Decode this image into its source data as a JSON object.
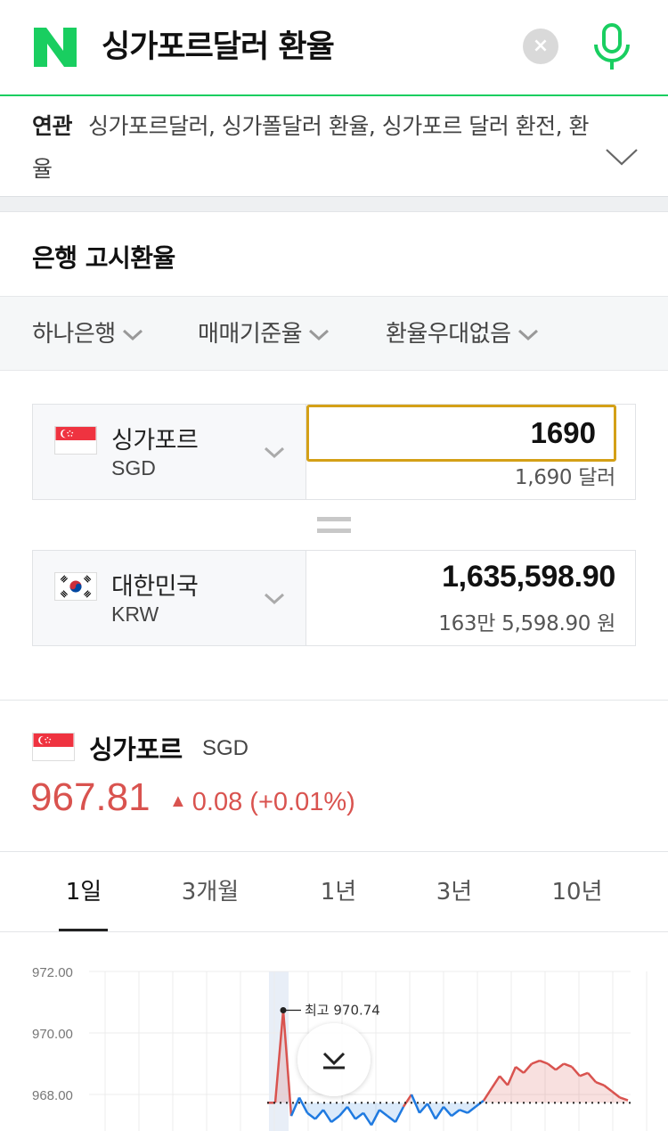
{
  "search": {
    "query": "싱가포르달러 환율",
    "clear_label": "×",
    "brand_color": "#19ce60"
  },
  "related": {
    "label": "연관",
    "terms": "싱가포르달러, 싱가폴달러 환율, 싱가포르 달러 환전, 환율"
  },
  "bank_rates": {
    "title": "은행 고시환율",
    "filters": {
      "bank": "하나은행",
      "rate_type": "매매기준율",
      "discount": "환율우대없음"
    }
  },
  "converter": {
    "from": {
      "name": "싱가포르",
      "code": "SGD",
      "input_value": "1690",
      "sub_text": "1,690 달러"
    },
    "to": {
      "name": "대한민국",
      "code": "KRW",
      "value": "1,635,598.90",
      "sub_text": "163만 5,598.90 원"
    }
  },
  "rate_summary": {
    "name": "싱가포르",
    "code": "SGD",
    "value": "967.81",
    "change": "0.08 (+0.01%)",
    "up_color": "#d9534f",
    "down_color": "#1f7ae0"
  },
  "tabs": [
    {
      "label": "1일",
      "active": true
    },
    {
      "label": "3개월",
      "active": false
    },
    {
      "label": "1년",
      "active": false
    },
    {
      "label": "3년",
      "active": false
    },
    {
      "label": "10년",
      "active": false
    }
  ],
  "chart_data": {
    "type": "line",
    "yticks": [
      "972.00",
      "970.00",
      "968.00"
    ],
    "ylim": [
      966.2,
      972.5
    ],
    "baseline": 967.73,
    "high_label": "최고 970.74",
    "high_value": 970.74,
    "series": [
      {
        "values": [
          967.73,
          967.73,
          970.74,
          967.3,
          967.9,
          967.4,
          967.2,
          967.5,
          967.1,
          967.3,
          967.6,
          967.2,
          967.4,
          967.0,
          967.5,
          967.3,
          967.1,
          967.6,
          968.0,
          967.4,
          967.7,
          967.2,
          967.6,
          967.3,
          967.5,
          967.4,
          967.6,
          967.8,
          968.2,
          968.6,
          968.3,
          968.9,
          968.7,
          969.0,
          969.1,
          969.0,
          968.8,
          969.0,
          968.9,
          968.6,
          968.7,
          968.4,
          968.3,
          968.1,
          967.9,
          967.81
        ]
      }
    ],
    "grid": true
  },
  "scroll_button": "chevron-down-icon"
}
